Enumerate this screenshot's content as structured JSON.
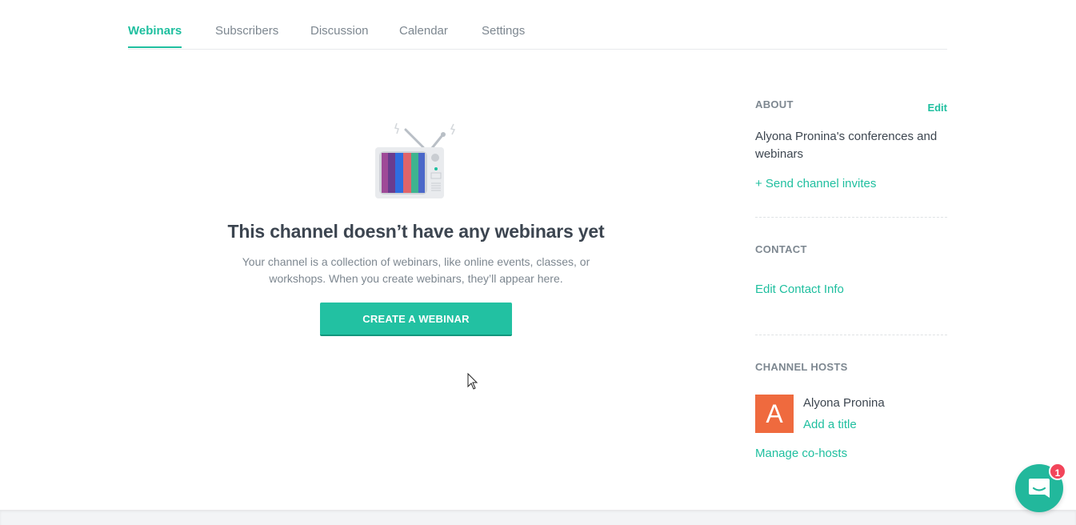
{
  "tabs": [
    {
      "label": "Webinars",
      "active": true
    },
    {
      "label": "Subscribers"
    },
    {
      "label": "Discussion"
    },
    {
      "label": "Calendar"
    },
    {
      "label": "Settings"
    }
  ],
  "empty_state": {
    "title": "This channel doesn’t have any webinars yet",
    "description": "Your channel is a collection of webinars, like online events, classes, or workshops. When you create webinars, they’ll appear here.",
    "button": "CREATE A WEBINAR",
    "illustration": "tv-icon"
  },
  "sidebar": {
    "about": {
      "title": "ABOUT",
      "edit": "Edit",
      "text": "Alyona Pronina's conferences and webinars",
      "invite": "+ Send channel invites"
    },
    "contact": {
      "title": "CONTACT",
      "link": "Edit Contact Info"
    },
    "hosts": {
      "title": "CHANNEL HOSTS",
      "avatar_letter": "A",
      "name": "Alyona Pronina",
      "add_title": "Add a title",
      "manage": "Manage co-hosts"
    }
  },
  "chat": {
    "badge": "1",
    "icon": "chat-icon"
  },
  "colors": {
    "accent": "#1fbf9f",
    "avatar": "#ef6a3e",
    "badge": "#f2455a"
  }
}
